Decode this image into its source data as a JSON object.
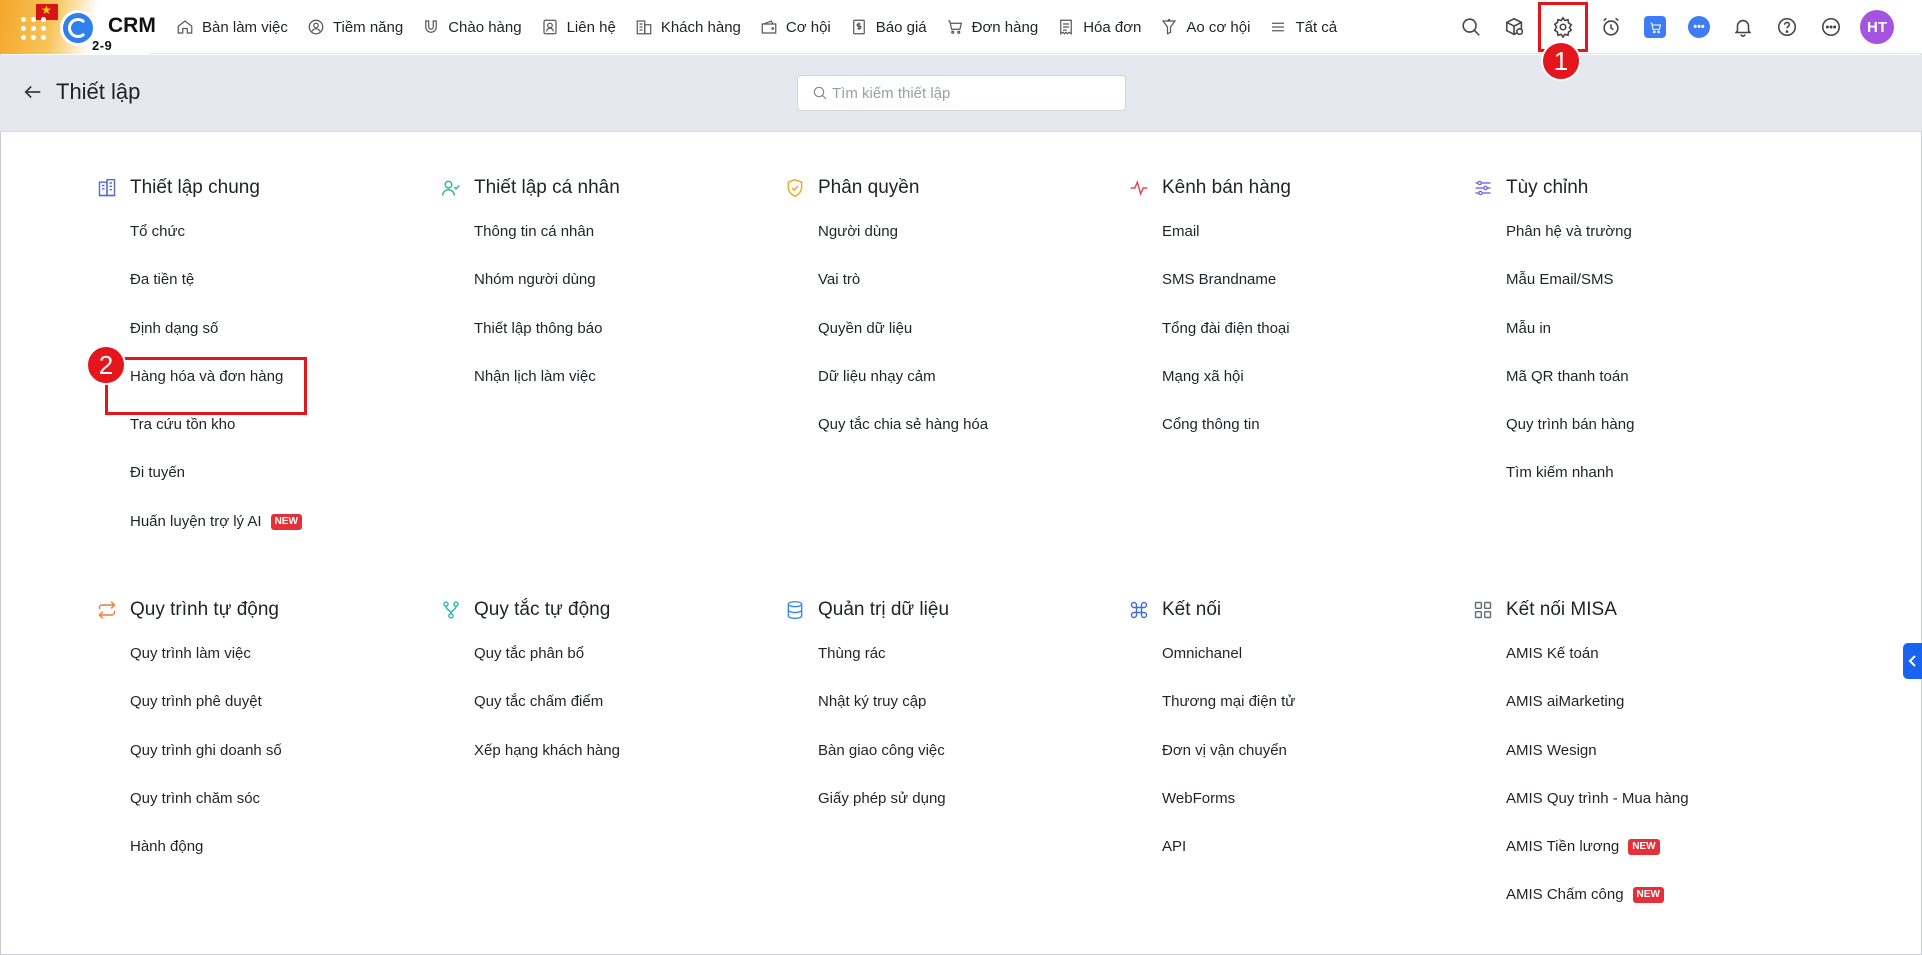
{
  "topnav": {
    "brand": "CRM",
    "brand_badge": "2-9",
    "items": [
      {
        "label": "Bàn làm việc",
        "icon": "home-icon"
      },
      {
        "label": "Tiềm năng",
        "icon": "user-circle-icon"
      },
      {
        "label": "Chào hàng",
        "icon": "magnet-icon"
      },
      {
        "label": "Liên hệ",
        "icon": "contact-card-icon"
      },
      {
        "label": "Khách hàng",
        "icon": "building-icon"
      },
      {
        "label": "Cơ hội",
        "icon": "wallet-icon"
      },
      {
        "label": "Báo giá",
        "icon": "dollar-doc-icon"
      },
      {
        "label": "Đơn hàng",
        "icon": "cart-icon"
      },
      {
        "label": "Hóa đơn",
        "icon": "invoice-icon"
      },
      {
        "label": "Ao cơ hội",
        "icon": "funnel-icon"
      },
      {
        "label": "Tất cả",
        "icon": "menu-icon"
      }
    ],
    "avatar_initials": "HT"
  },
  "subheader": {
    "title": "Thiết lập",
    "search_placeholder": "Tìm kiếm thiết lập"
  },
  "annotations": {
    "step1": "1",
    "step2": "2"
  },
  "sections_row1": [
    {
      "title": "Thiết lập chung",
      "icon": "building-icon",
      "color": "#5b6cd6",
      "items": [
        {
          "label": "Tổ chức"
        },
        {
          "label": "Đa tiền tệ"
        },
        {
          "label": "Định dạng số"
        },
        {
          "label": "Hàng hóa và đơn hàng"
        },
        {
          "label": "Tra cứu tồn kho"
        },
        {
          "label": "Đi tuyến"
        },
        {
          "label": "Huấn luyện trợ lý AI",
          "tag": "NEW"
        }
      ]
    },
    {
      "title": "Thiết lập cá nhân",
      "icon": "user-check-icon",
      "color": "#2bb58f",
      "items": [
        {
          "label": "Thông tin cá nhân"
        },
        {
          "label": "Nhóm người dùng"
        },
        {
          "label": "Thiết lập thông báo"
        },
        {
          "label": "Nhận lịch làm việc"
        }
      ]
    },
    {
      "title": "Phân quyền",
      "icon": "shield-check-icon",
      "color": "#f0a71b",
      "items": [
        {
          "label": "Người dùng"
        },
        {
          "label": "Vai trò"
        },
        {
          "label": "Quyền dữ liệu"
        },
        {
          "label": "Dữ liệu nhạy cảm"
        },
        {
          "label": "Quy tắc chia sẻ hàng hóa"
        }
      ]
    },
    {
      "title": "Kênh bán hàng",
      "icon": "pulse-icon",
      "color": "#e8434b",
      "items": [
        {
          "label": "Email"
        },
        {
          "label": "SMS Brandname"
        },
        {
          "label": "Tổng đài điện thoại"
        },
        {
          "label": "Mạng xã hội"
        },
        {
          "label": "Cổng thông tin"
        }
      ]
    },
    {
      "title": "Tùy chỉnh",
      "icon": "sliders-icon",
      "color": "#7a6be0",
      "items": [
        {
          "label": "Phân hệ và trường"
        },
        {
          "label": "Mẫu Email/SMS"
        },
        {
          "label": "Mẫu in"
        },
        {
          "label": "Mã QR thanh toán"
        },
        {
          "label": "Quy trình bán hàng"
        },
        {
          "label": "Tìm kiếm nhanh"
        }
      ]
    }
  ],
  "sections_row2": [
    {
      "title": "Quy trình tự động",
      "icon": "repeat-icon",
      "color": "#f07a3a",
      "items": [
        {
          "label": "Quy trình làm việc"
        },
        {
          "label": "Quy trình phê duyệt"
        },
        {
          "label": "Quy trình ghi doanh số"
        },
        {
          "label": "Quy trình chăm sóc"
        },
        {
          "label": "Hành động"
        }
      ]
    },
    {
      "title": "Quy tắc tự động",
      "icon": "git-branch-icon",
      "color": "#2bb5b0",
      "items": [
        {
          "label": "Quy tắc phân bổ"
        },
        {
          "label": "Quy tắc chấm điểm"
        },
        {
          "label": "Xếp hạng khách hàng"
        }
      ]
    },
    {
      "title": "Quản trị dữ liệu",
      "icon": "database-icon",
      "color": "#3d8bf0",
      "items": [
        {
          "label": "Thùng rác"
        },
        {
          "label": "Nhật ký truy cập"
        },
        {
          "label": "Bàn giao công việc"
        },
        {
          "label": "Giấy phép sử dụng"
        }
      ]
    },
    {
      "title": "Kết nối",
      "icon": "command-icon",
      "color": "#3d6fd6",
      "items": [
        {
          "label": "Omnichanel"
        },
        {
          "label": "Thương mại điện tử"
        },
        {
          "label": "Đơn vị vận chuyển"
        },
        {
          "label": "WebForms"
        },
        {
          "label": "API"
        }
      ]
    },
    {
      "title": "Kết nối MISA",
      "icon": "grid-icon",
      "color": "#666c75",
      "items": [
        {
          "label": "AMIS Kế toán"
        },
        {
          "label": "AMIS aiMarketing"
        },
        {
          "label": "AMIS Wesign"
        },
        {
          "label": "AMIS Quy trình - Mua hàng"
        },
        {
          "label": "AMIS Tiền lương",
          "tag": "NEW"
        },
        {
          "label": "AMIS Chấm công",
          "tag": "NEW"
        }
      ]
    }
  ]
}
